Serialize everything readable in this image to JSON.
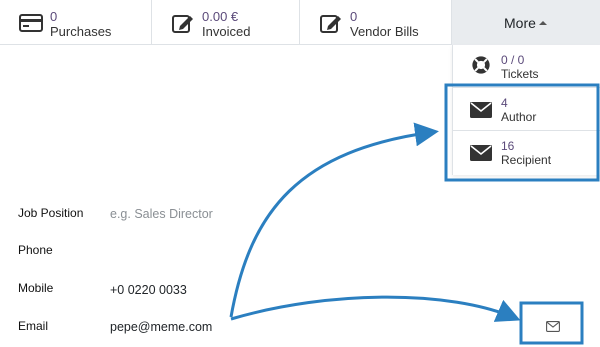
{
  "stat_buttons": [
    {
      "value": "0",
      "label": "Purchases",
      "icon": "credit-card-icon"
    },
    {
      "value": "0.00 €",
      "label": "Invoiced",
      "icon": "edit-icon"
    },
    {
      "value": "0",
      "label": "Vendor Bills",
      "icon": "edit-icon"
    }
  ],
  "more": {
    "label": "More",
    "icon": "caret-up-icon"
  },
  "dropdown": {
    "items": [
      {
        "value": "0 / 0",
        "label": "Tickets",
        "icon": "life-ring-icon"
      },
      {
        "value": "4",
        "label": "Author",
        "icon": "envelope-icon"
      },
      {
        "value": "16",
        "label": "Recipient",
        "icon": "envelope-icon"
      }
    ]
  },
  "form": {
    "job_position": {
      "label": "Job Position",
      "placeholder": "e.g. Sales Director"
    },
    "phone": {
      "label": "Phone",
      "value": ""
    },
    "mobile": {
      "label": "Mobile",
      "value": "+0 0220 0033"
    },
    "email": {
      "label": "Email",
      "value": "pepe@meme.com"
    }
  },
  "colors": {
    "accent": "#2b7fc0",
    "value_text": "#5b4a7a"
  }
}
